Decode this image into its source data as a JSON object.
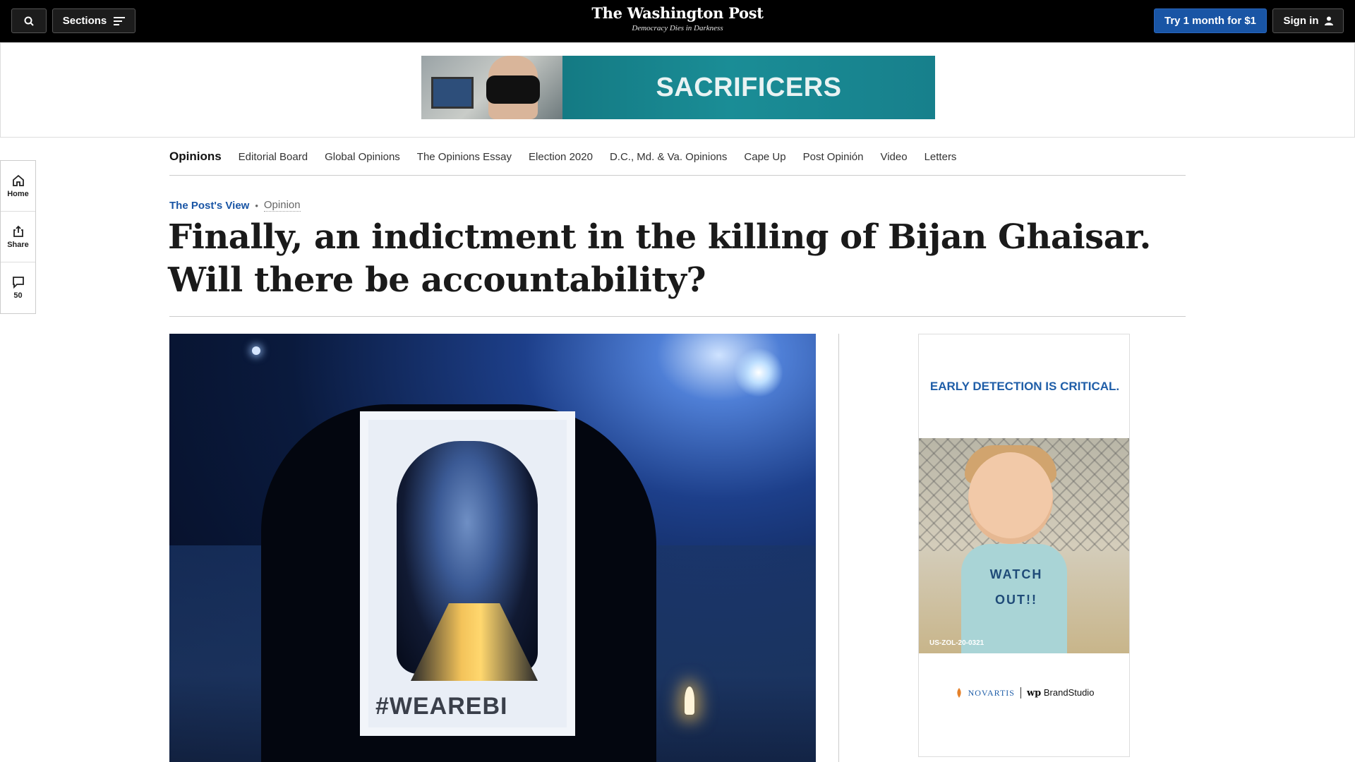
{
  "topbar": {
    "sections_label": "Sections",
    "logo_title": "The Washington Post",
    "logo_tagline": "Democracy Dies in Darkness",
    "subscribe_label": "Try 1 month for $1",
    "signin_label": "Sign in"
  },
  "banner_ad": {
    "text": "SACRIFICERS"
  },
  "opinions_nav": {
    "items": [
      "Opinions",
      "Editorial Board",
      "Global Opinions",
      "The Opinions Essay",
      "Election 2020",
      "D.C., Md. & Va. Opinions",
      "Cape Up",
      "Post Opinión",
      "Video",
      "Letters"
    ]
  },
  "left_rail": {
    "home_label": "Home",
    "share_label": "Share",
    "comments_count": "50"
  },
  "article": {
    "kicker": "The Post's View",
    "section": "Opinion",
    "headline": "Finally, an indictment in the killing of Bijan Ghaisar. Will there be accountability?",
    "hero_hashtag": "#WEAREBI"
  },
  "side_ad": {
    "headline": "EARLY DETECTION IS CRITICAL.",
    "shirt_text": "WATCH OUT!!",
    "code": "US-ZOL-20-0321",
    "sponsor": "NOVARTIS",
    "brand_wp": "wp",
    "brand_studio": "BrandStudio"
  },
  "colors": {
    "topbar_bg": "#000000",
    "accent_blue": "#1955a5",
    "ad_teal": "#1a8d96"
  }
}
